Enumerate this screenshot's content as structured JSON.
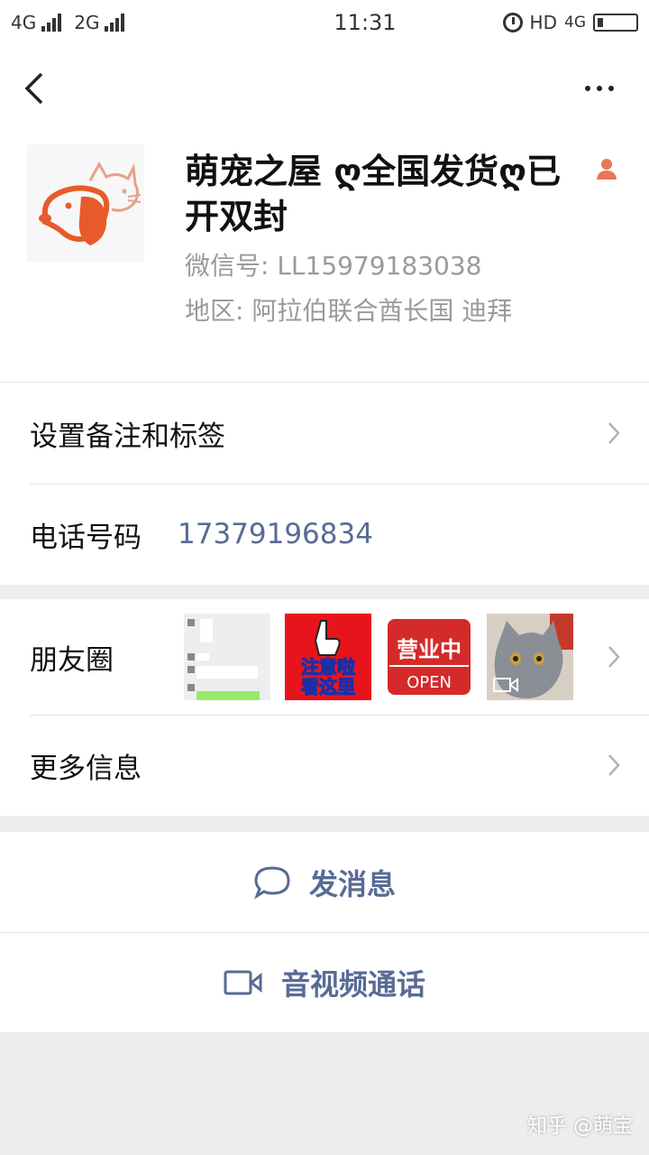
{
  "status_bar": {
    "net1": "4G",
    "net2": "2G",
    "time": "11:31",
    "hd": "HD",
    "net3": "4G"
  },
  "profile": {
    "name": "萌宠之屋 ღ全国发货ღ已开双封",
    "wechat_id": "微信号:  LL15979183038",
    "region": "地区:  阿拉伯联合酋长国  迪拜"
  },
  "rows": {
    "remark": "设置备注和标签",
    "phone_label": "电话号码",
    "phone_value": "17379196834",
    "moments": "朋友圈",
    "more_info": "更多信息"
  },
  "moments_thumbs": {
    "sign_text_1": "注意啦",
    "sign_text_2": "看这里",
    "open_text_1": "营业中",
    "open_text_2": "OPEN"
  },
  "actions": {
    "message": "发消息",
    "call": "音视频通话"
  },
  "watermark": "知乎 @萌宝",
  "colors": {
    "link_blue": "#576b95",
    "gray_text": "#9a9a9a",
    "background": "#ededed"
  }
}
